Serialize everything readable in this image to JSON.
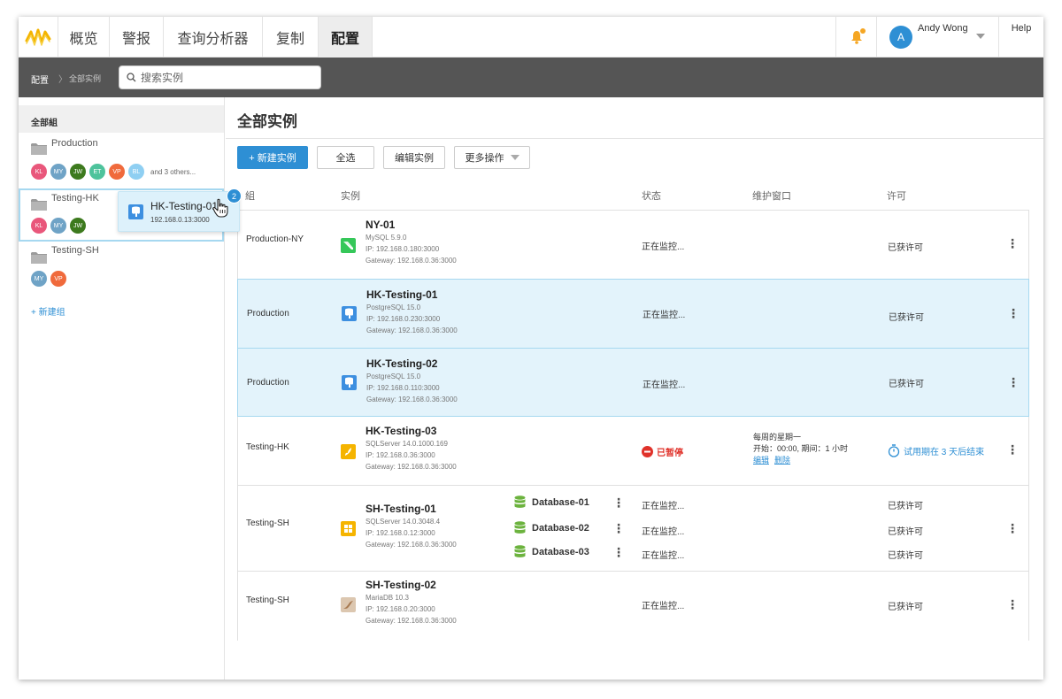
{
  "nav": {
    "tabs": [
      {
        "label": "概览"
      },
      {
        "label": "警报"
      },
      {
        "label": "查询分析器"
      },
      {
        "label": "复制"
      },
      {
        "label": "配置"
      }
    ],
    "user_initial": "A",
    "user_name": "Andy Wong",
    "help": "Help"
  },
  "breadcrumb": {
    "root": "配置",
    "sep": "〉",
    "current": "全部实例"
  },
  "search": {
    "placeholder": "搜索实例"
  },
  "sidebar": {
    "header": "全部組",
    "groups": [
      {
        "name": "Production",
        "members": [
          "KL",
          "MY",
          "JW",
          "ET",
          "VP",
          "BL"
        ],
        "others": "and 3 others..."
      },
      {
        "name": "Testing-HK",
        "members": [
          "KL",
          "MY",
          "JW"
        ]
      },
      {
        "name": "Testing-SH",
        "members": [
          "MY",
          "VP"
        ]
      }
    ],
    "add_group": "+ 新建组"
  },
  "drag": {
    "name": "HK-Testing-01",
    "ip": "192.168.0.13:3000",
    "count": "2"
  },
  "main": {
    "title": "全部实例",
    "toolbar": {
      "new": "+ 新建实例",
      "select_all": "全选",
      "edit": "编辑实例",
      "more": "更多操作"
    },
    "columns": {
      "group": "組",
      "instance": "实例",
      "status": "状态",
      "maintenance": "维护窗口",
      "license": "许可"
    }
  },
  "rows": [
    {
      "group": "Production-NY",
      "name": "NY-01",
      "engine": "MySQL 5.9.0",
      "ip": "IP: 192.168.0.180:3000",
      "gateway": "Gateway: 192.168.0.36:3000",
      "status": "正在监控...",
      "license": "已获许可"
    },
    {
      "group": "Production",
      "name": "HK-Testing-01",
      "engine": "PostgreSQL 15.0",
      "ip": "IP: 192.168.0.230:3000",
      "gateway": "Gateway: 192.168.0.36:3000",
      "status": "正在监控...",
      "license": "已获许可"
    },
    {
      "group": "Production",
      "name": "HK-Testing-02",
      "engine": "PostgreSQL 15.0",
      "ip": "IP: 192.168.0.110:3000",
      "gateway": "Gateway: 192.168.0.36:3000",
      "status": "正在监控...",
      "license": "已获许可"
    },
    {
      "group": "Testing-HK",
      "name": "HK-Testing-03",
      "engine": "SQLServer 14.0.1000.169",
      "ip": "IP: 192.168.0.36:3000",
      "gateway": "Gateway: 192.168.0.36:3000",
      "status": "已暂停",
      "maint_line1": "每周的星期一",
      "maint_line2": "开始：00:00, 期间：1 小时",
      "maint_edit": "编辑",
      "maint_delete": "删除",
      "license": "试用期在 3 天后结束"
    },
    {
      "group": "Testing-SH",
      "name": "SH-Testing-01",
      "engine": "SQLServer 14.0.3048.4",
      "ip": "IP: 192.168.0.12:3000",
      "gateway": "Gateway: 192.168.0.36:3000",
      "databases": [
        {
          "name": "Database-01",
          "status": "正在监控...",
          "license": "已获许可"
        },
        {
          "name": "Database-02",
          "status": "正在监控...",
          "license": "已获许可"
        },
        {
          "name": "Database-03",
          "status": "正在监控...",
          "license": "已获许可"
        }
      ]
    },
    {
      "group": "Testing-SH",
      "name": "SH-Testing-02",
      "engine": "MariaDB 10.3",
      "ip": "IP: 192.168.0.20:3000",
      "gateway": "Gateway: 192.168.0.36:3000",
      "status": "正在监控...",
      "license": "已获许可"
    }
  ],
  "colors": {
    "accent": "#2e8fd4",
    "highlight_row": "#e3f3fb",
    "paused": "#e0322a",
    "db_green": "#6cb33e",
    "bell": "#f5a623"
  }
}
